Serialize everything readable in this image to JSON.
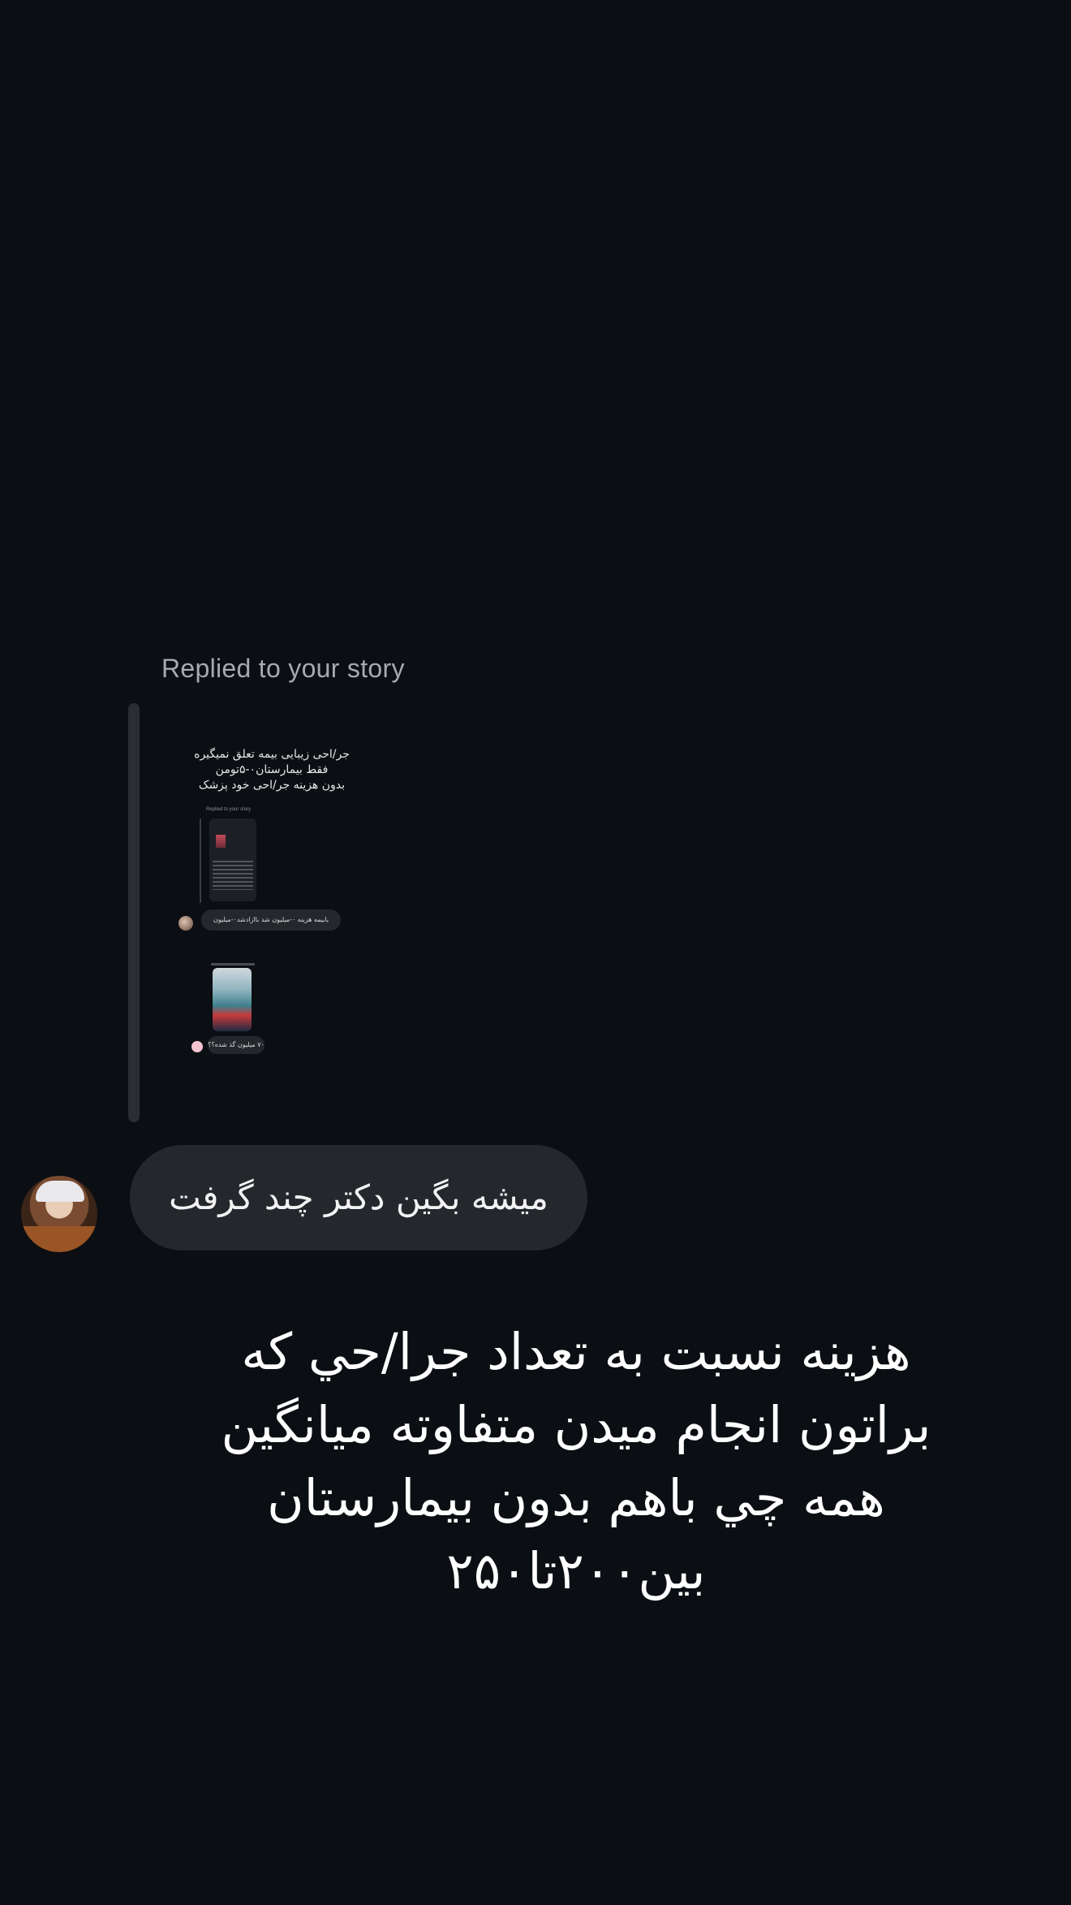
{
  "reply": {
    "label": "Replied to your story"
  },
  "story": {
    "text": "جر/احی زیبایی بیمه تعلق نمیگیره\nفقط بیمارستان۰-۵تومن\nبدون هزینه جر/احی خود پزشک",
    "mini_label": "Replied to your story",
    "mini_bubble_1": "بابیمه هزینه ۰-میلیون شد باازادشد۰-میلیون",
    "mini_bubble_2": "۷۰ میلیون گذ شده؟؟"
  },
  "message": {
    "text": "میشه بگین دکتر چند گرفت"
  },
  "caption": {
    "text": "هزینه نسبت به تعداد جرا/حي كه\nبراتون انجام میدن متفاوته میانگین\nهمه چي باهم بدون بیمارستان\nبین۲۰۰تا۲۵۰"
  },
  "icons": {
    "avatar": "profile-avatar"
  },
  "colors": {
    "background": "#0b0e12",
    "bubble": "#24272c",
    "muted_text": "#a6aab0"
  }
}
